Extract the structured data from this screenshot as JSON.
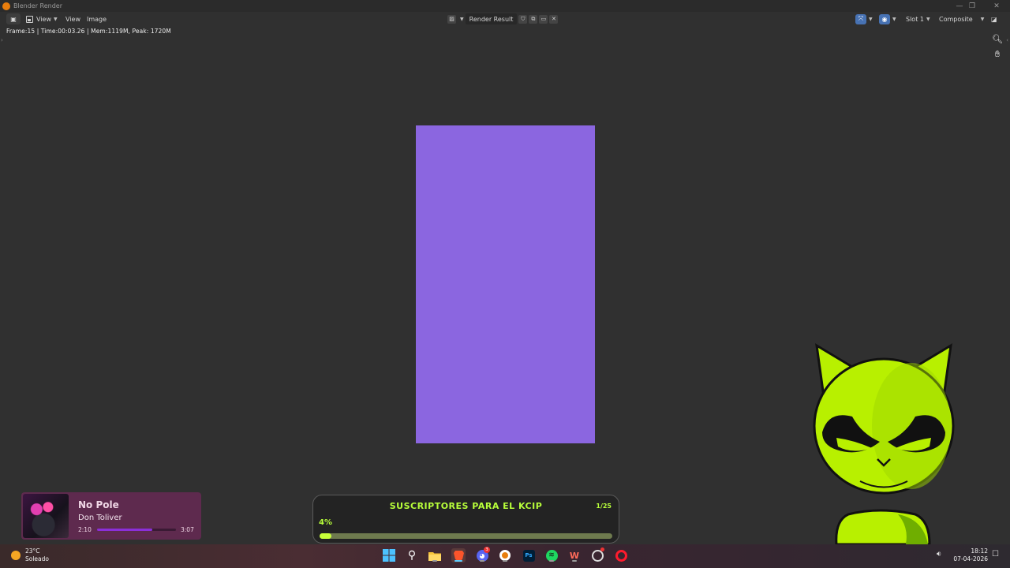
{
  "window": {
    "title": "Blender Render"
  },
  "header": {
    "menus": [
      "View",
      "View",
      "Image"
    ],
    "image_name": "Render Result",
    "slot": "Slot 1",
    "layer": "Composite"
  },
  "info_line": "Frame:15 | Time:00:03.26 | Mem:1119M, Peak: 1720M",
  "render": {
    "color": "#8b66e0"
  },
  "now_playing": {
    "title": "No Pole",
    "artist": "Don Toliver",
    "elapsed": "2:10",
    "duration": "3:07",
    "progress": 0.7
  },
  "goal": {
    "title": "SUSCRIPTORES PARA EL KCIP",
    "count": "1/25",
    "percent": "4%",
    "progress": 0.04
  },
  "taskbar": {
    "weather_temp": "23°C",
    "weather_desc": "Soleado",
    "time": "18:12",
    "date": "07-04-2026",
    "discord_badge": "3"
  }
}
